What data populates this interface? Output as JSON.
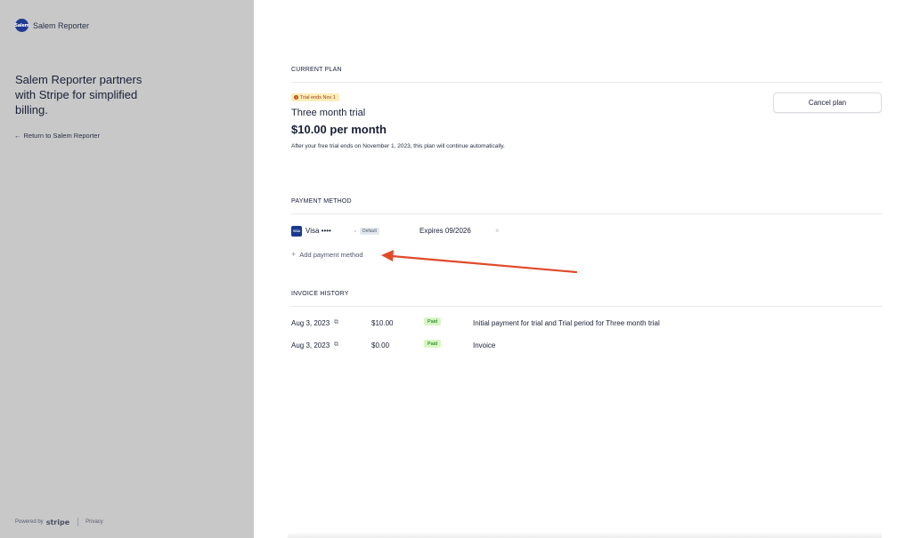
{
  "sidebar": {
    "brand_logo_text": "Salem",
    "brand_name": "Salem Reporter",
    "headline": "Salem Reporter partners with Stripe for simplified billing.",
    "return_link": "Return to Salem Reporter",
    "powered_by": "Powered by",
    "stripe_wordmark": "stripe",
    "privacy_link": "Privacy"
  },
  "current_plan": {
    "section_title": "CURRENT PLAN",
    "trial_badge": "Trial ends Nov 1",
    "plan_name": "Three month trial",
    "price": "$10.00 per month",
    "note": "After your free trial ends on November 1, 2023, this plan will continue automatically.",
    "cancel_label": "Cancel plan"
  },
  "payment_method": {
    "section_title": "PAYMENT METHOD",
    "card_brand_icon": "VISA",
    "card_label": "Visa ••••",
    "default_badge": "Default",
    "expires": "Expires 09/2026",
    "remove_icon": "×",
    "add_label": "Add payment method"
  },
  "invoice_history": {
    "section_title": "INVOICE HISTORY",
    "rows": [
      {
        "date": "Aug 3, 2023",
        "amount": "$10.00",
        "status": "Paid",
        "description": "Initial payment for trial and Trial period for Three month trial"
      },
      {
        "date": "Aug 3, 2023",
        "amount": "$0.00",
        "status": "Paid",
        "description": "Invoice"
      }
    ]
  },
  "colors": {
    "sidebar_bg": "#c8c8c8",
    "arrow": "#e04a2a",
    "paid_badge_bg": "#d7f7c2",
    "trial_badge_bg": "#fcedb9"
  },
  "icons": {
    "back_arrow": "←",
    "plus": "+",
    "external_link": "⧉",
    "warning": "!"
  }
}
